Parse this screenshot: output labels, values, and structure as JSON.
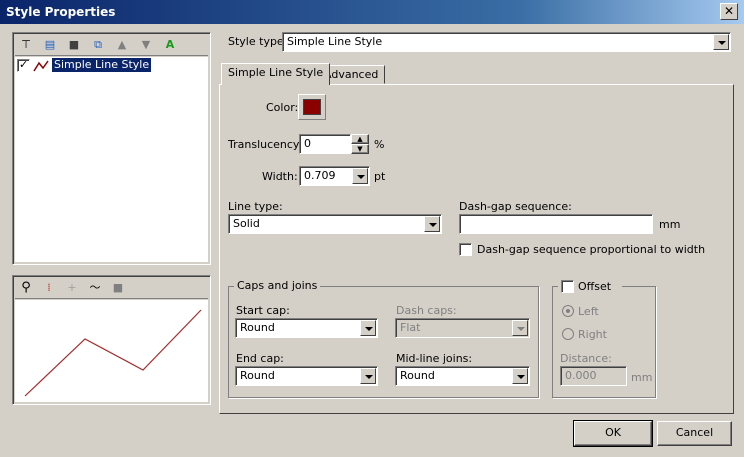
{
  "window": {
    "title": "Style Properties",
    "close_glyph": "✕"
  },
  "tree": {
    "item_label": "Simple Line Style",
    "checked": true
  },
  "style_type": {
    "label": "Style type:",
    "value": "Simple Line Style"
  },
  "tabs": [
    {
      "label": "Simple Line Style"
    },
    {
      "label": "Advanced"
    }
  ],
  "color": {
    "label": "Color:",
    "value": "#8b0000"
  },
  "translucency": {
    "label": "Translucency:",
    "value": "0",
    "unit": "%"
  },
  "width": {
    "label": "Width:",
    "value": "0.709",
    "unit": "pt"
  },
  "line_type": {
    "label": "Line type:",
    "value": "Solid"
  },
  "dash_gap": {
    "label": "Dash-gap sequence:",
    "value": "",
    "unit": "mm",
    "proportional_label": "Dash-gap sequence proportional to width",
    "proportional_checked": false
  },
  "caps": {
    "group_label": "Caps and joins",
    "start_cap_label": "Start cap:",
    "start_cap_value": "Round",
    "dash_caps_label": "Dash caps:",
    "dash_caps_value": "Flat",
    "end_cap_label": "End cap:",
    "end_cap_value": "Round",
    "midline_label": "Mid-line joins:",
    "midline_value": "Round"
  },
  "offset": {
    "label": "Offset",
    "checked": false,
    "left_label": "Left",
    "right_label": "Right",
    "distance_label": "Distance:",
    "distance_value": "0.000",
    "unit": "mm"
  },
  "buttons": {
    "ok": "OK",
    "cancel": "Cancel"
  },
  "preview": {
    "line_color": "#a52a2a"
  }
}
